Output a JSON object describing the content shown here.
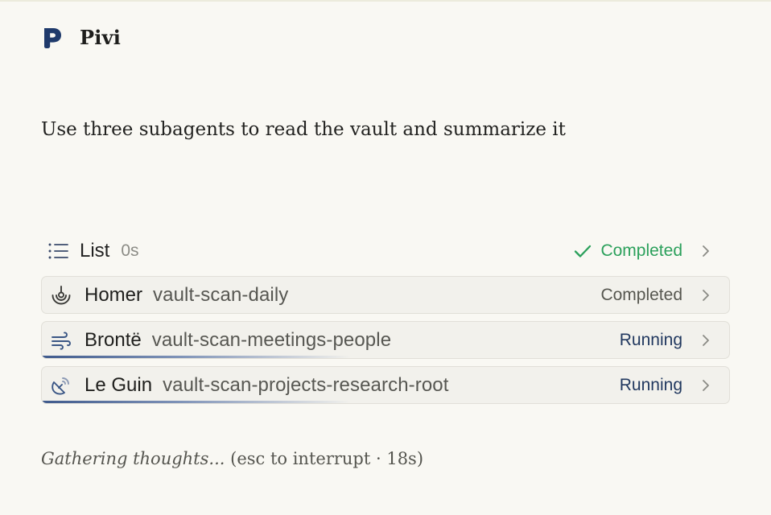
{
  "app": {
    "name": "Pivi"
  },
  "prompt": "Use three subagents to read the vault and summarize it",
  "task": {
    "label": "List",
    "elapsed": "0s",
    "status": "Completed",
    "status_color": "#2ba05b",
    "icon": "list-icon"
  },
  "agents": [
    {
      "name": "Homer",
      "task": "vault-scan-daily",
      "status": "Completed",
      "icon": "orbit-icon",
      "progress": null
    },
    {
      "name": "Brontë",
      "task": "vault-scan-meetings-people",
      "status": "Running",
      "icon": "wind-icon",
      "progress": 0.45
    },
    {
      "name": "Le Guin",
      "task": "vault-scan-projects-research-root",
      "status": "Running",
      "icon": "satellite-dish-icon",
      "progress": 0.45
    }
  ],
  "footer": {
    "thinking": "Gathering thoughts...",
    "hint": "(esc to interrupt · 18s)"
  },
  "colors": {
    "background": "#f9f8f3",
    "brand_logo": "#1f3a6b",
    "completed": "#2ba05b",
    "running": "#21385f"
  }
}
